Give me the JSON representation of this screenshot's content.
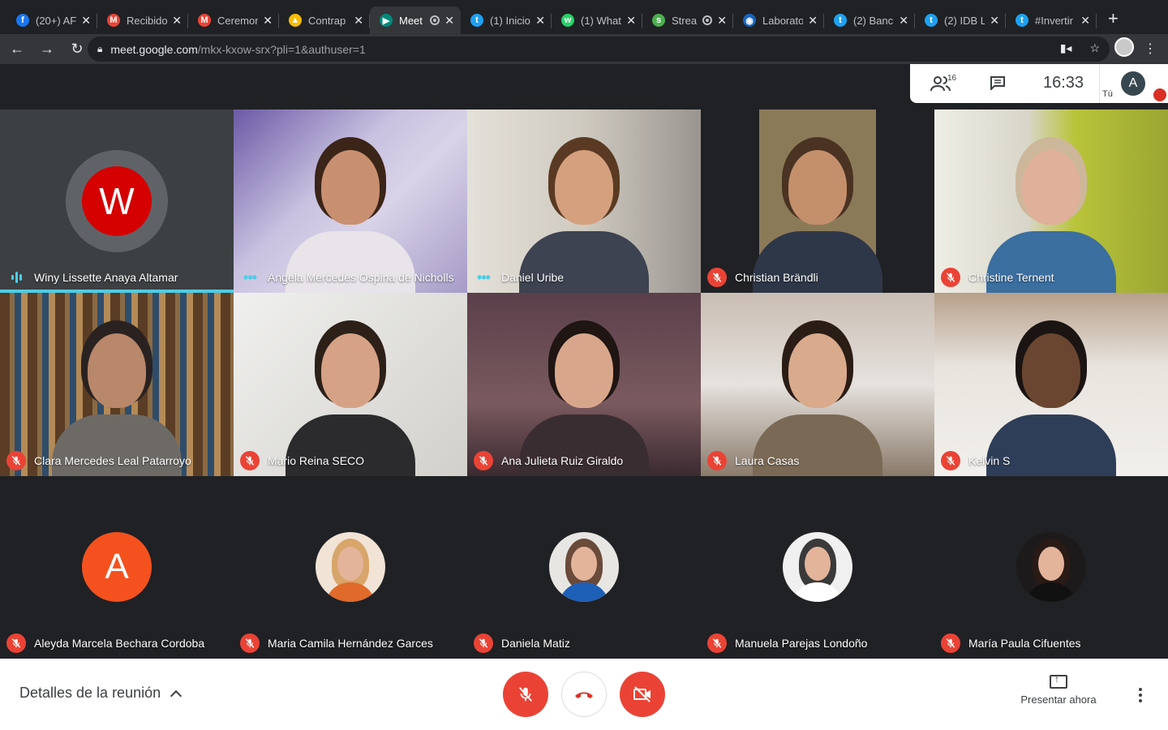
{
  "browser": {
    "tabs": [
      {
        "label": "(20+) AF",
        "icon": "facebook-icon",
        "color": "#1877f2",
        "glyph": "f"
      },
      {
        "label": "Recibido",
        "icon": "gmail-icon",
        "color": "#ea4335",
        "glyph": "M"
      },
      {
        "label": "Ceremon",
        "icon": "gmail-icon",
        "color": "#ea4335",
        "glyph": "M"
      },
      {
        "label": "Contrap",
        "icon": "drive-icon",
        "color": "#fbbc04",
        "glyph": "▲"
      },
      {
        "label": "Meet",
        "icon": "meet-icon",
        "color": "#00897b",
        "glyph": "▶",
        "active": true,
        "recording": true
      },
      {
        "label": "(1) Inicio",
        "icon": "twitter-icon",
        "color": "#1da1f2",
        "glyph": "t"
      },
      {
        "label": "(1) What",
        "icon": "whatsapp-icon",
        "color": "#25d366",
        "glyph": "w"
      },
      {
        "label": "Strea",
        "icon": "streamyard-icon",
        "color": "#4caf50",
        "glyph": "s",
        "recording": true
      },
      {
        "label": "Laborato",
        "icon": "lab-icon",
        "color": "#1565c0",
        "glyph": "◉"
      },
      {
        "label": "(2) Banc",
        "icon": "twitter-icon",
        "color": "#1da1f2",
        "glyph": "t"
      },
      {
        "label": "(2) IDB L",
        "icon": "twitter-icon",
        "color": "#1da1f2",
        "glyph": "t"
      },
      {
        "label": "#Invertir",
        "icon": "twitter-icon",
        "color": "#1da1f2",
        "glyph": "t"
      }
    ],
    "new_tab": "+",
    "url_host": "meet.google.com",
    "url_path": "/mkx-kxow-srx?pli=1&authuser=1"
  },
  "meet": {
    "participant_count": "16",
    "time": "16:33",
    "self_initial": "A",
    "self_label": "Tú",
    "grid": [
      {
        "name": "Winy Lissette Anaya Altamar",
        "status": "speaking",
        "avatar_initial": "W",
        "avatar_color": "#d50000"
      },
      {
        "name": "Angela Mercedes Ospina de Nicholls",
        "status": "dots"
      },
      {
        "name": "Daniel Uribe",
        "status": "dots"
      },
      {
        "name": "Christian Brändli",
        "status": "muted"
      },
      {
        "name": "Christine Ternent",
        "status": "muted"
      },
      {
        "name": "Clara Mercedes Leal Patarroyo",
        "status": "muted"
      },
      {
        "name": "Mario Reina SECO",
        "status": "muted"
      },
      {
        "name": "Ana Julieta Ruiz Giraldo",
        "status": "muted"
      },
      {
        "name": "Laura Casas",
        "status": "muted"
      },
      {
        "name": "Kelvin S",
        "status": "muted"
      }
    ],
    "bottom": [
      {
        "name": "Aleyda Marcela Bechara Cordoba",
        "avatar_initial": "A",
        "avatar_color": "#f4511e"
      },
      {
        "name": "Maria Camila Hernández Garces"
      },
      {
        "name": "Daniela Matiz"
      },
      {
        "name": "Manuela Parejas Londoño"
      },
      {
        "name": "María Paula Cifuentes"
      }
    ],
    "controls": {
      "details_label": "Detalles de la reunión",
      "present_label": "Presentar ahora"
    }
  }
}
